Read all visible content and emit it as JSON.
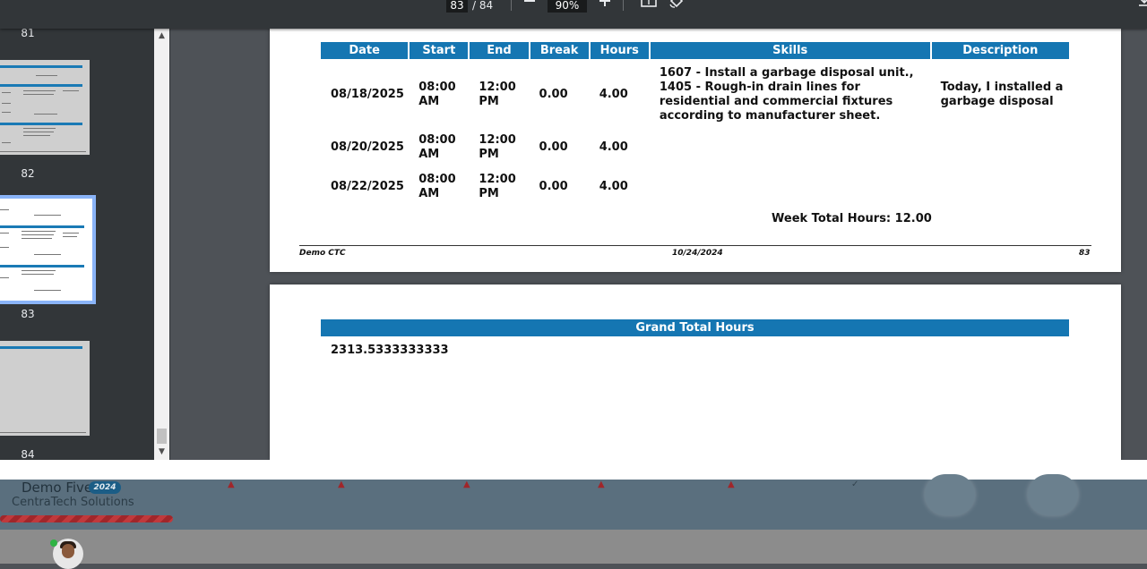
{
  "toolbar": {
    "current_page": "83",
    "total_pages": "/ 84",
    "zoom": "90%",
    "zoom_out_icon": "minus-icon",
    "zoom_in_icon": "plus-icon",
    "fit_icon": "fit-page-icon",
    "rotate_icon": "rotate-icon",
    "download_icon": "download-icon"
  },
  "sidebar": {
    "thumbnails": [
      {
        "number": "81"
      },
      {
        "number": "82"
      },
      {
        "number": "83"
      },
      {
        "number": "84"
      }
    ],
    "active_thumbnail_color": "#8ab4f8"
  },
  "page83": {
    "headers": [
      "Date",
      "Start",
      "End",
      "Break",
      "Hours",
      "Skills",
      "Description"
    ],
    "rows": [
      {
        "date": "08/18/2025",
        "start": "08:00 AM",
        "end": "12:00 PM",
        "break": "0.00",
        "hours": "4.00",
        "skills": "1607 - Install a garbage disposal unit., 1405 - Rough-in drain lines for residential and commercial fixtures according to manufacturer sheet.",
        "description": "Today, I installed a garbage disposal"
      },
      {
        "date": "08/20/2025",
        "start": "08:00 AM",
        "end": "12:00 PM",
        "break": "0.00",
        "hours": "4.00",
        "skills": "",
        "description": ""
      },
      {
        "date": "08/22/2025",
        "start": "08:00 AM",
        "end": "12:00 PM",
        "break": "0.00",
        "hours": "4.00",
        "skills": "",
        "description": ""
      }
    ],
    "week_total": "Week Total Hours: 12.00",
    "footer_left": "Demo CTC",
    "footer_center": "10/24/2024",
    "footer_right": "83",
    "header_color": "#1576b2"
  },
  "page84": {
    "grand_total_label": "Grand Total Hours",
    "grand_total_value": "2313.5333333333"
  },
  "app": {
    "name": "Demo Five",
    "badge": "2024",
    "company": "CentraTech Solutions",
    "status_color": "#2fb344"
  }
}
